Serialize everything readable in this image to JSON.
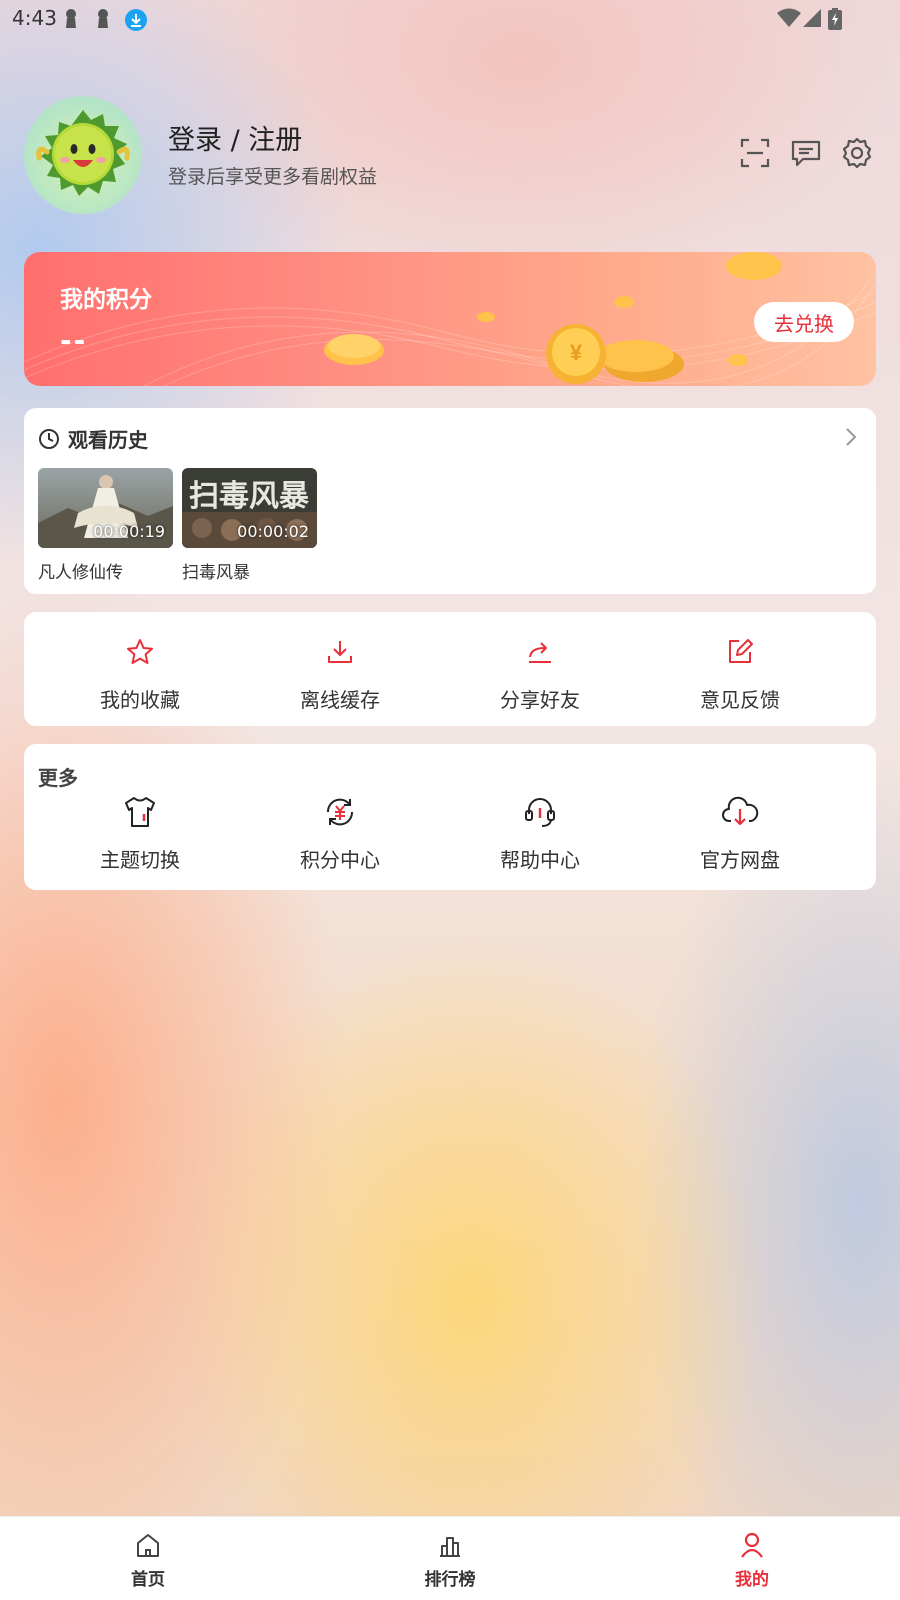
{
  "status_bar": {
    "time": "4:43",
    "icons": [
      "notification-key-icon",
      "notification-key-icon",
      "download-icon",
      "wifi-icon",
      "signal-icon",
      "battery-charging-icon"
    ]
  },
  "profile": {
    "login_title": "登录 / 注册",
    "login_subtitle": "登录后享受更多看剧权益",
    "avatar_icon": "durian-mascot-icon",
    "header_icons": [
      "scan-icon",
      "message-icon",
      "settings-icon"
    ]
  },
  "points": {
    "title": "我的积分",
    "value": "--",
    "redeem_label": "去兑换"
  },
  "history": {
    "title": "观看历史",
    "items": [
      {
        "title": "凡人修仙传",
        "time": "00:00:19"
      },
      {
        "title": "扫毒风暴",
        "time": "00:00:02",
        "poster_text": "扫毒风暴"
      }
    ]
  },
  "actions": [
    {
      "label": "我的收藏",
      "icon": "star-icon"
    },
    {
      "label": "离线缓存",
      "icon": "download-icon"
    },
    {
      "label": "分享好友",
      "icon": "share-icon"
    },
    {
      "label": "意见反馈",
      "icon": "edit-icon"
    }
  ],
  "more": {
    "title": "更多",
    "items": [
      {
        "label": "主题切换",
        "icon": "tshirt-icon"
      },
      {
        "label": "积分中心",
        "icon": "points-exchange-icon"
      },
      {
        "label": "帮助中心",
        "icon": "headset-icon"
      },
      {
        "label": "官方网盘",
        "icon": "cloud-download-icon"
      }
    ]
  },
  "bottom_nav": [
    {
      "label": "首页",
      "icon": "home-icon",
      "active": false
    },
    {
      "label": "排行榜",
      "icon": "ranking-icon",
      "active": false
    },
    {
      "label": "我的",
      "icon": "user-icon",
      "active": true
    }
  ],
  "colors": {
    "accent": "#e8303a",
    "card": "#ffffff"
  }
}
